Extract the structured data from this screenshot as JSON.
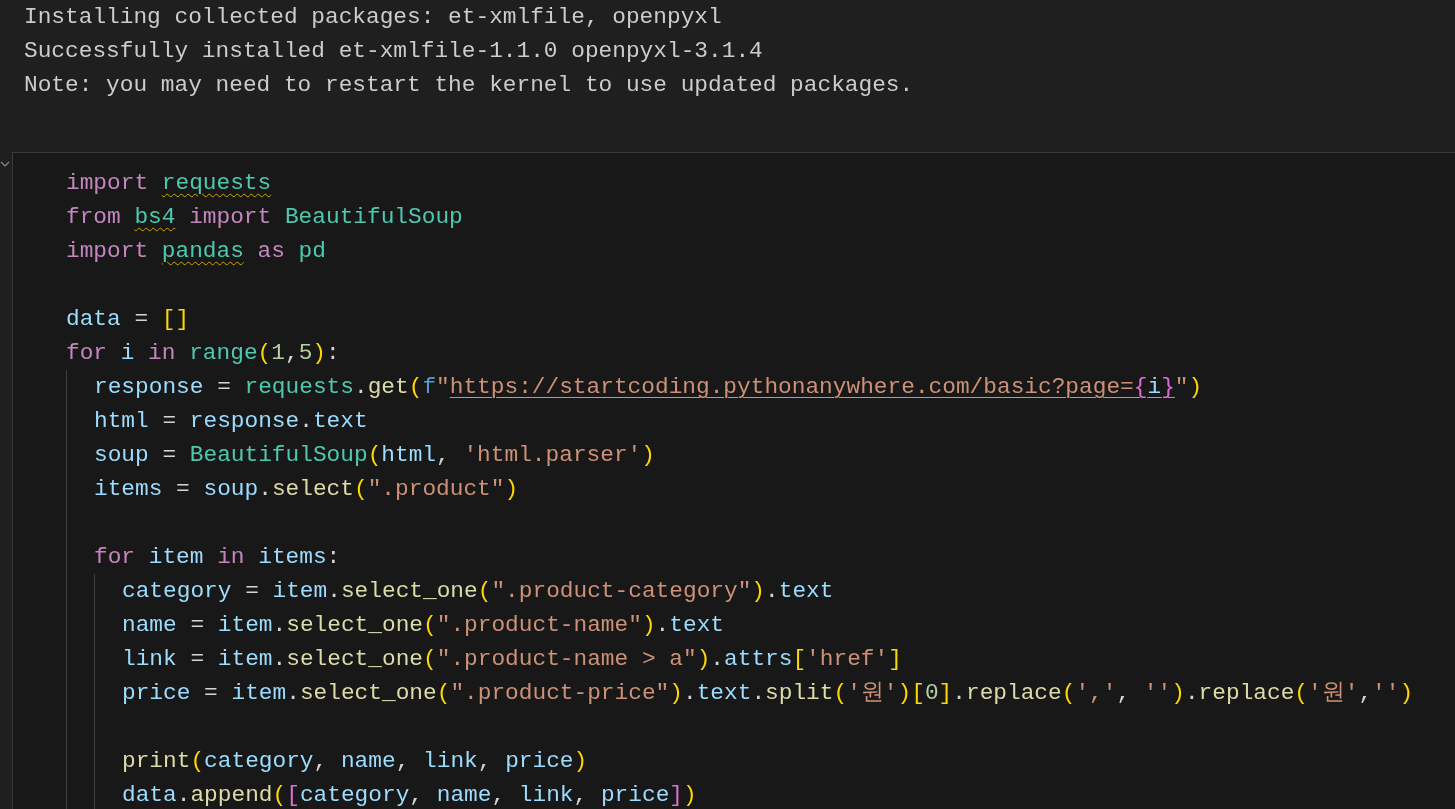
{
  "output": {
    "lines": [
      "Installing collected packages: et-xmlfile, openpyxl",
      "Successfully installed et-xmlfile-1.1.0 openpyxl-3.1.4",
      "Note: you may need to restart the kernel to use updated packages."
    ]
  },
  "cell": {
    "lines": [
      {
        "kind": "code",
        "tokens": [
          {
            "t": "import ",
            "kind": "keyword"
          },
          {
            "t": "requests",
            "kind": "module",
            "warn": true
          }
        ]
      },
      {
        "kind": "code",
        "tokens": [
          {
            "t": "from ",
            "kind": "keyword"
          },
          {
            "t": "bs4",
            "kind": "module",
            "warn": true
          },
          {
            "t": " import ",
            "kind": "keyword"
          },
          {
            "t": "BeautifulSoup",
            "kind": "module"
          }
        ]
      },
      {
        "kind": "code",
        "tokens": [
          {
            "t": "import ",
            "kind": "keyword"
          },
          {
            "t": "pandas",
            "kind": "module",
            "warn": true
          },
          {
            "t": " as ",
            "kind": "keyword"
          },
          {
            "t": "pd",
            "kind": "module"
          }
        ]
      },
      {
        "kind": "blank"
      },
      {
        "kind": "code",
        "tokens": [
          {
            "t": "data",
            "kind": "variable"
          },
          {
            "t": " = ",
            "kind": "plain"
          },
          {
            "t": "[]",
            "kind": "bracket1"
          }
        ]
      },
      {
        "kind": "code",
        "tokens": [
          {
            "t": "for ",
            "kind": "keyword"
          },
          {
            "t": "i",
            "kind": "variable"
          },
          {
            "t": " in ",
            "kind": "keyword"
          },
          {
            "t": "range",
            "kind": "module"
          },
          {
            "t": "(",
            "kind": "bracket1"
          },
          {
            "t": "1",
            "kind": "number"
          },
          {
            "t": ",",
            "kind": "plain"
          },
          {
            "t": "5",
            "kind": "number"
          },
          {
            "t": ")",
            "kind": "bracket1"
          },
          {
            "t": ":",
            "kind": "plain"
          }
        ],
        "children": [
          {
            "kind": "code",
            "tokens": [
              {
                "t": "response",
                "kind": "variable"
              },
              {
                "t": " = ",
                "kind": "plain"
              },
              {
                "t": "requests",
                "kind": "module"
              },
              {
                "t": ".",
                "kind": "plain"
              },
              {
                "t": "get",
                "kind": "function"
              },
              {
                "t": "(",
                "kind": "bracket1"
              },
              {
                "t": "f",
                "kind": "storage"
              },
              {
                "t": "\"",
                "kind": "string"
              },
              {
                "t": "https://startcoding.pythonanywhere.com/basic?page=",
                "kind": "string",
                "link": true
              },
              {
                "t": "{",
                "kind": "bracket2",
                "link": true
              },
              {
                "t": "i",
                "kind": "variable",
                "link": true
              },
              {
                "t": "}",
                "kind": "bracket2",
                "link": true
              },
              {
                "t": "\"",
                "kind": "string"
              },
              {
                "t": ")",
                "kind": "bracket1"
              }
            ]
          },
          {
            "kind": "code",
            "tokens": [
              {
                "t": "html",
                "kind": "variable"
              },
              {
                "t": " = ",
                "kind": "plain"
              },
              {
                "t": "response",
                "kind": "variable"
              },
              {
                "t": ".",
                "kind": "plain"
              },
              {
                "t": "text",
                "kind": "variable"
              }
            ]
          },
          {
            "kind": "code",
            "tokens": [
              {
                "t": "soup",
                "kind": "variable"
              },
              {
                "t": " = ",
                "kind": "plain"
              },
              {
                "t": "BeautifulSoup",
                "kind": "module"
              },
              {
                "t": "(",
                "kind": "bracket1"
              },
              {
                "t": "html",
                "kind": "variable"
              },
              {
                "t": ", ",
                "kind": "plain"
              },
              {
                "t": "'html.parser'",
                "kind": "string"
              },
              {
                "t": ")",
                "kind": "bracket1"
              }
            ]
          },
          {
            "kind": "code",
            "tokens": [
              {
                "t": "items",
                "kind": "variable"
              },
              {
                "t": " = ",
                "kind": "plain"
              },
              {
                "t": "soup",
                "kind": "variable"
              },
              {
                "t": ".",
                "kind": "plain"
              },
              {
                "t": "select",
                "kind": "function"
              },
              {
                "t": "(",
                "kind": "bracket1"
              },
              {
                "t": "\".product\"",
                "kind": "string"
              },
              {
                "t": ")",
                "kind": "bracket1"
              }
            ]
          },
          {
            "kind": "blank"
          },
          {
            "kind": "code",
            "tokens": [
              {
                "t": "for ",
                "kind": "keyword"
              },
              {
                "t": "item",
                "kind": "variable"
              },
              {
                "t": " in ",
                "kind": "keyword"
              },
              {
                "t": "items",
                "kind": "variable"
              },
              {
                "t": ":",
                "kind": "plain"
              }
            ],
            "children": [
              {
                "kind": "code",
                "tokens": [
                  {
                    "t": "category",
                    "kind": "variable"
                  },
                  {
                    "t": " = ",
                    "kind": "plain"
                  },
                  {
                    "t": "item",
                    "kind": "variable"
                  },
                  {
                    "t": ".",
                    "kind": "plain"
                  },
                  {
                    "t": "select_one",
                    "kind": "function"
                  },
                  {
                    "t": "(",
                    "kind": "bracket1"
                  },
                  {
                    "t": "\".product-category\"",
                    "kind": "string"
                  },
                  {
                    "t": ")",
                    "kind": "bracket1"
                  },
                  {
                    "t": ".",
                    "kind": "plain"
                  },
                  {
                    "t": "text",
                    "kind": "variable"
                  }
                ]
              },
              {
                "kind": "code",
                "tokens": [
                  {
                    "t": "name",
                    "kind": "variable"
                  },
                  {
                    "t": " = ",
                    "kind": "plain"
                  },
                  {
                    "t": "item",
                    "kind": "variable"
                  },
                  {
                    "t": ".",
                    "kind": "plain"
                  },
                  {
                    "t": "select_one",
                    "kind": "function"
                  },
                  {
                    "t": "(",
                    "kind": "bracket1"
                  },
                  {
                    "t": "\".product-name\"",
                    "kind": "string"
                  },
                  {
                    "t": ")",
                    "kind": "bracket1"
                  },
                  {
                    "t": ".",
                    "kind": "plain"
                  },
                  {
                    "t": "text",
                    "kind": "variable"
                  }
                ]
              },
              {
                "kind": "code",
                "tokens": [
                  {
                    "t": "link",
                    "kind": "variable"
                  },
                  {
                    "t": " = ",
                    "kind": "plain"
                  },
                  {
                    "t": "item",
                    "kind": "variable"
                  },
                  {
                    "t": ".",
                    "kind": "plain"
                  },
                  {
                    "t": "select_one",
                    "kind": "function"
                  },
                  {
                    "t": "(",
                    "kind": "bracket1"
                  },
                  {
                    "t": "\".product-name > a\"",
                    "kind": "string"
                  },
                  {
                    "t": ")",
                    "kind": "bracket1"
                  },
                  {
                    "t": ".",
                    "kind": "plain"
                  },
                  {
                    "t": "attrs",
                    "kind": "variable"
                  },
                  {
                    "t": "[",
                    "kind": "bracket1"
                  },
                  {
                    "t": "'href'",
                    "kind": "string"
                  },
                  {
                    "t": "]",
                    "kind": "bracket1"
                  }
                ]
              },
              {
                "kind": "code",
                "tokens": [
                  {
                    "t": "price",
                    "kind": "variable"
                  },
                  {
                    "t": " = ",
                    "kind": "plain"
                  },
                  {
                    "t": "item",
                    "kind": "variable"
                  },
                  {
                    "t": ".",
                    "kind": "plain"
                  },
                  {
                    "t": "select_one",
                    "kind": "function"
                  },
                  {
                    "t": "(",
                    "kind": "bracket1"
                  },
                  {
                    "t": "\".product-price\"",
                    "kind": "string"
                  },
                  {
                    "t": ")",
                    "kind": "bracket1"
                  },
                  {
                    "t": ".",
                    "kind": "plain"
                  },
                  {
                    "t": "text",
                    "kind": "variable"
                  },
                  {
                    "t": ".",
                    "kind": "plain"
                  },
                  {
                    "t": "split",
                    "kind": "function"
                  },
                  {
                    "t": "(",
                    "kind": "bracket1"
                  },
                  {
                    "t": "'원'",
                    "kind": "string"
                  },
                  {
                    "t": ")",
                    "kind": "bracket1"
                  },
                  {
                    "t": "[",
                    "kind": "bracket1"
                  },
                  {
                    "t": "0",
                    "kind": "number"
                  },
                  {
                    "t": "]",
                    "kind": "bracket1"
                  },
                  {
                    "t": ".",
                    "kind": "plain"
                  },
                  {
                    "t": "replace",
                    "kind": "function"
                  },
                  {
                    "t": "(",
                    "kind": "bracket1"
                  },
                  {
                    "t": "','",
                    "kind": "string"
                  },
                  {
                    "t": ", ",
                    "kind": "plain"
                  },
                  {
                    "t": "''",
                    "kind": "string"
                  },
                  {
                    "t": ")",
                    "kind": "bracket1"
                  },
                  {
                    "t": ".",
                    "kind": "plain"
                  },
                  {
                    "t": "replace",
                    "kind": "function"
                  },
                  {
                    "t": "(",
                    "kind": "bracket1"
                  },
                  {
                    "t": "'원'",
                    "kind": "string"
                  },
                  {
                    "t": ",",
                    "kind": "plain"
                  },
                  {
                    "t": "''",
                    "kind": "string"
                  },
                  {
                    "t": ")",
                    "kind": "bracket1"
                  }
                ]
              },
              {
                "kind": "blank"
              },
              {
                "kind": "code",
                "tokens": [
                  {
                    "t": "print",
                    "kind": "function"
                  },
                  {
                    "t": "(",
                    "kind": "bracket1"
                  },
                  {
                    "t": "category",
                    "kind": "variable"
                  },
                  {
                    "t": ", ",
                    "kind": "plain"
                  },
                  {
                    "t": "name",
                    "kind": "variable"
                  },
                  {
                    "t": ", ",
                    "kind": "plain"
                  },
                  {
                    "t": "link",
                    "kind": "variable"
                  },
                  {
                    "t": ", ",
                    "kind": "plain"
                  },
                  {
                    "t": "price",
                    "kind": "variable"
                  },
                  {
                    "t": ")",
                    "kind": "bracket1"
                  }
                ]
              },
              {
                "kind": "code",
                "tokens": [
                  {
                    "t": "data",
                    "kind": "variable"
                  },
                  {
                    "t": ".",
                    "kind": "plain"
                  },
                  {
                    "t": "append",
                    "kind": "function"
                  },
                  {
                    "t": "(",
                    "kind": "bracket1"
                  },
                  {
                    "t": "[",
                    "kind": "bracket2"
                  },
                  {
                    "t": "category",
                    "kind": "variable"
                  },
                  {
                    "t": ", ",
                    "kind": "plain"
                  },
                  {
                    "t": "name",
                    "kind": "variable"
                  },
                  {
                    "t": ", ",
                    "kind": "plain"
                  },
                  {
                    "t": "link",
                    "kind": "variable"
                  },
                  {
                    "t": ", ",
                    "kind": "plain"
                  },
                  {
                    "t": "price",
                    "kind": "variable"
                  },
                  {
                    "t": "]",
                    "kind": "bracket2"
                  },
                  {
                    "t": ")",
                    "kind": "bracket1"
                  }
                ]
              }
            ]
          }
        ]
      }
    ]
  }
}
